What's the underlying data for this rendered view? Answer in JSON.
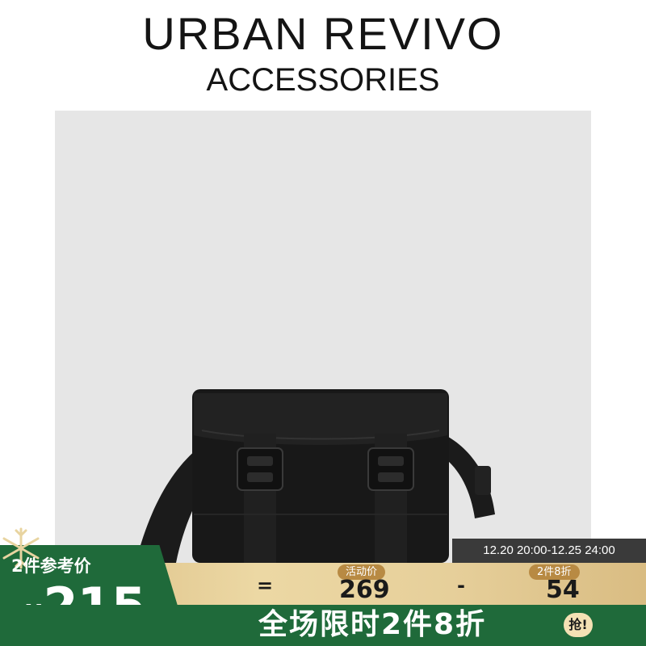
{
  "brand": {
    "title": "URBAN REVIVO",
    "subtitle": "ACCESSORIES"
  },
  "product": {
    "image_icon": "crossbody-bag-image"
  },
  "time_window": "12.20 20:00-12.25 24:00",
  "pricing": {
    "two_piece_label": "2件参考价",
    "currency": "¥",
    "reference_price": "215",
    "equals": "=",
    "minus": "-",
    "activity_label": "活动价",
    "activity_price": "269",
    "two_piece_discount_label": "2件8折",
    "discount_amount": "54"
  },
  "promo": {
    "text": "全场限时2件8折",
    "grab_label": "抢!"
  },
  "colors": {
    "green": "#1f6a3a",
    "gold": "#e6cf9a",
    "photo_bg": "#e6e6e6"
  }
}
